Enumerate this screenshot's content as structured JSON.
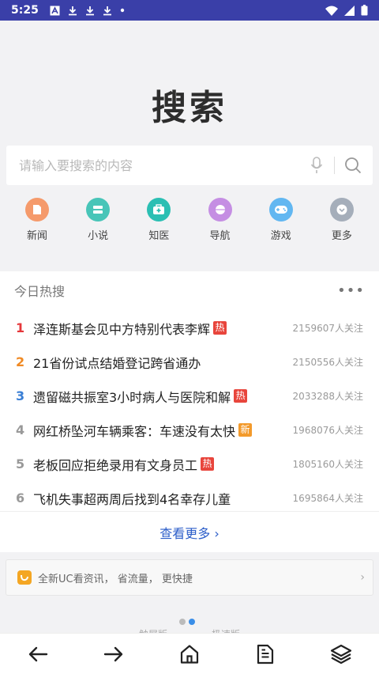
{
  "status": {
    "time": "5:25"
  },
  "header": {
    "title": "搜索"
  },
  "search": {
    "placeholder": "请输入要搜索的内容",
    "value": ""
  },
  "categories": [
    {
      "label": "新闻",
      "icon": "news-icon",
      "color": "#f59a6b"
    },
    {
      "label": "小说",
      "icon": "book-icon",
      "color": "#48c5b8"
    },
    {
      "label": "知医",
      "icon": "medical-icon",
      "color": "#2bbfb3"
    },
    {
      "label": "导航",
      "icon": "navigation-icon",
      "color": "#c58ee3"
    },
    {
      "label": "游戏",
      "icon": "gamepad-icon",
      "color": "#62b7f1"
    },
    {
      "label": "更多",
      "icon": "more-icon",
      "color": "#a5aeba"
    }
  ],
  "hot": {
    "heading": "今日热搜",
    "items": [
      {
        "rank": "1",
        "title": "泽连斯基会见中方特别代表李辉",
        "badge": "热",
        "count": "2159607人关注"
      },
      {
        "rank": "2",
        "title": "21省份试点结婚登记跨省通办",
        "badge": "",
        "count": "2150556人关注"
      },
      {
        "rank": "3",
        "title": "遗留磁共振室3小时病人与医院和解",
        "badge": "热",
        "count": "2033288人关注"
      },
      {
        "rank": "4",
        "title": "网红桥坠河车辆乘客：车速没有太快",
        "badge": "新",
        "count": "1968076人关注"
      },
      {
        "rank": "5",
        "title": "老板回应拒绝录用有文身员工",
        "badge": "热",
        "count": "1805160人关注"
      },
      {
        "rank": "6",
        "title": "飞机失事超两周后找到4名幸存儿童",
        "badge": "",
        "count": "1695864人关注"
      }
    ],
    "see_more": "查看更多"
  },
  "uc": {
    "text": "全新UC看资讯， 省流量， 更快捷"
  },
  "modes": [
    "触屏版",
    "极速版"
  ],
  "colors": {
    "statusbar": "#3a3fa8",
    "rank1": "#e5383b",
    "rank2": "#f08a24",
    "rank3": "#3a7fd5",
    "rank_other": "#999999",
    "badge_hot": "#e8453c",
    "badge_new": "#f39a2b",
    "link": "#2c5ec9"
  }
}
